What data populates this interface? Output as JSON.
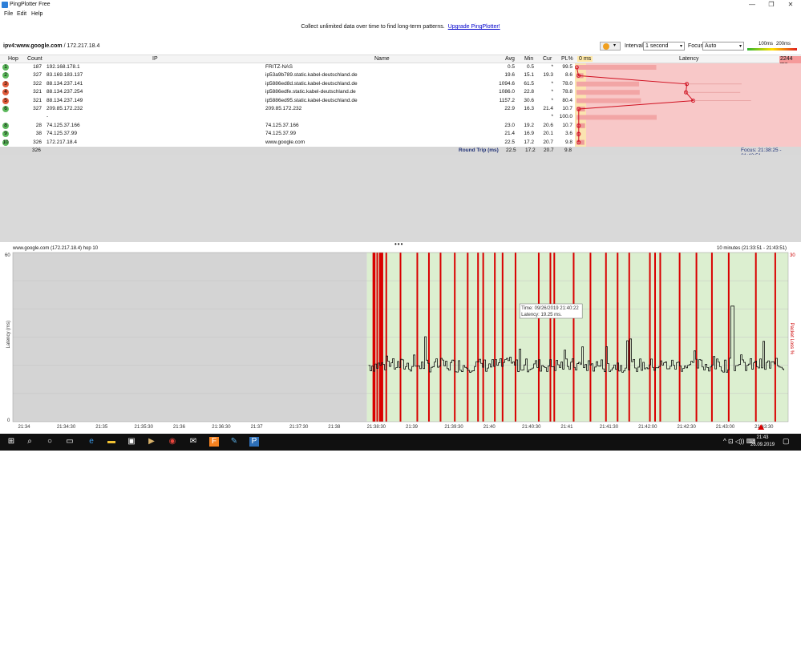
{
  "window": {
    "title": "PingPlotter Free",
    "minimize": "—",
    "maximize": "❐",
    "close": "✕"
  },
  "menu": [
    "File",
    "Edit",
    "Help"
  ],
  "promo": {
    "text": "Collect unlimited data over time to find long-term patterns.",
    "link": "Upgrade PingPlotter!"
  },
  "target": {
    "host": "ipv4:www.google.com",
    "ip": " / 172.217.18.4"
  },
  "controls": {
    "interval_label": "Interval",
    "interval_value": "1 second",
    "focus_label": "Focus",
    "focus_value": "Auto"
  },
  "scale": {
    "low": "100ms",
    "high": "200ms"
  },
  "columns": {
    "hop": "Hop",
    "count": "Count",
    "ip": "IP",
    "name": "Name",
    "avg": "Avg",
    "min": "Min",
    "cur": "Cur",
    "pl": "PL%",
    "latency_start": "0 ms",
    "latency": "Latency",
    "latency_end": "2244 ms"
  },
  "hops": [
    {
      "hop": "1",
      "count": "187",
      "ip": "192.168.178.1",
      "name": "FRITZ-NAS",
      "avg": "0.5",
      "min": "0.5",
      "cur": "*",
      "pl": "99.5",
      "color": "#5cb85c",
      "bar": 0.001,
      "pl_frac": 0.995
    },
    {
      "hop": "2",
      "count": "327",
      "ip": "83.169.183.137",
      "name": "ip53a9b789.static.kabel-deutschland.de",
      "avg": "19.6",
      "min": "15.1",
      "cur": "19.3",
      "pl": "8.6",
      "color": "#5cb85c",
      "bar": 0.009,
      "pl_frac": 0.086
    },
    {
      "hop": "3",
      "count": "322",
      "ip": "88.134.237.141",
      "name": "ip5886ed8d.static.kabel-deutschland.de",
      "avg": "1094.6",
      "min": "61.5",
      "cur": "*",
      "pl": "78.0",
      "color": "#e05a3a",
      "bar": 0.488,
      "pl_frac": 0.78
    },
    {
      "hop": "4",
      "count": "321",
      "ip": "88.134.237.254",
      "name": "ip5886edfe.static.kabel-deutschland.de",
      "avg": "1086.0",
      "min": "22.8",
      "cur": "*",
      "pl": "78.8",
      "color": "#e05a3a",
      "bar": 0.484,
      "pl_frac": 0.788
    },
    {
      "hop": "5",
      "count": "321",
      "ip": "88.134.237.149",
      "name": "ip5886ed95.static.kabel-deutschland.de",
      "avg": "1157.2",
      "min": "30.6",
      "cur": "*",
      "pl": "80.4",
      "color": "#e05a3a",
      "bar": 0.516,
      "pl_frac": 0.804
    },
    {
      "hop": "6",
      "count": "327",
      "ip": "209.85.172.232",
      "name": "209.85.172.232",
      "avg": "22.9",
      "min": "16.3",
      "cur": "21.4",
      "pl": "10.7",
      "color": "#5cb85c",
      "bar": 0.01,
      "pl_frac": 0.107
    },
    {
      "hop": "",
      "count": "",
      "ip": "-",
      "name": "",
      "avg": "",
      "min": "",
      "cur": "*",
      "pl": "100.0",
      "color": "",
      "bar": 0,
      "pl_frac": 1.0
    },
    {
      "hop": "8",
      "count": "28",
      "ip": "74.125.37.166",
      "name": "74.125.37.166",
      "avg": "23.0",
      "min": "19.2",
      "cur": "20.6",
      "pl": "10.7",
      "color": "#5cb85c",
      "bar": 0.01,
      "pl_frac": 0.107
    },
    {
      "hop": "9",
      "count": "38",
      "ip": "74.125.37.99",
      "name": "74.125.37.99",
      "avg": "21.4",
      "min": "16.9",
      "cur": "20.1",
      "pl": "3.6",
      "color": "#5cb85c",
      "bar": 0.01,
      "pl_frac": 0.036
    },
    {
      "hop": "10",
      "count": "326",
      "ip": "172.217.18.4",
      "name": "www.google.com",
      "avg": "22.5",
      "min": "17.2",
      "cur": "20.7",
      "pl": "9.8",
      "color": "#5cb85c",
      "bar": 0.01,
      "pl_frac": 0.098
    }
  ],
  "roundtrip": {
    "count": "326",
    "label": "Round Trip (ms)",
    "avg": "22.5",
    "min": "17.2",
    "cur": "20.7",
    "pl": "9.8",
    "focus": "Focus: 21:38:25 - 21:43:51"
  },
  "graph": {
    "title": "www.google.com (172.217.18.4) hop 10",
    "range": "10 minutes (21:33:51 - 21:43:51)",
    "y_left_label": "Latency (ms)",
    "y_right_label": "Packet Loss %",
    "y_max_label": "60",
    "y_min_label": "0",
    "pl_max_label": "30",
    "tooltip_time": "Time: 09/26/2019 21:40:22",
    "tooltip_latency": "Latency: 19.25 ms."
  },
  "chart_data": {
    "type": "line",
    "title": "www.google.com (172.217.18.4) hop 10",
    "ylabel": "Latency (ms)",
    "y2label": "Packet Loss %",
    "ylim": [
      0,
      60
    ],
    "y2lim": [
      0,
      30
    ],
    "x_ticks": [
      "21:34",
      "21:34:30",
      "21:35",
      "21:35:30",
      "21:36",
      "21:36:30",
      "21:37",
      "21:37:30",
      "21:38",
      "21:38:30",
      "21:39",
      "21:39:30",
      "21:40",
      "21:40:30",
      "21:41",
      "21:41:30",
      "21:42:00",
      "21:42:30",
      "21:43:00",
      "21:43:30"
    ],
    "x_range": [
      "21:33:51",
      "21:43:51"
    ],
    "data_start": "21:38:25",
    "latency_typical_ms": 20,
    "latency_peak_ms": 41,
    "packet_loss_events": [
      "21:38:30",
      "21:38:31",
      "21:38:33",
      "21:38:35",
      "21:38:36",
      "21:38:37",
      "21:38:40",
      "21:38:51",
      "21:39:04",
      "21:39:13",
      "21:39:22",
      "21:39:33",
      "21:39:43",
      "21:39:51",
      "21:39:55",
      "21:40:04",
      "21:40:10",
      "21:40:20",
      "21:40:38",
      "21:40:47",
      "21:40:50",
      "21:41:05",
      "21:41:18",
      "21:41:30",
      "21:41:39",
      "21:41:48",
      "21:42:04",
      "21:42:08",
      "21:42:12",
      "21:42:27",
      "21:42:40",
      "21:42:52",
      "21:43:05",
      "21:43:26",
      "21:43:41"
    ],
    "grid": true
  },
  "taskbar": {
    "time": "21:43",
    "date": "26.09.2019"
  },
  "icons": {
    "start": "windows-icon",
    "search": "search-icon",
    "cortana": "cortana-icon",
    "taskview": "task-view-icon"
  }
}
